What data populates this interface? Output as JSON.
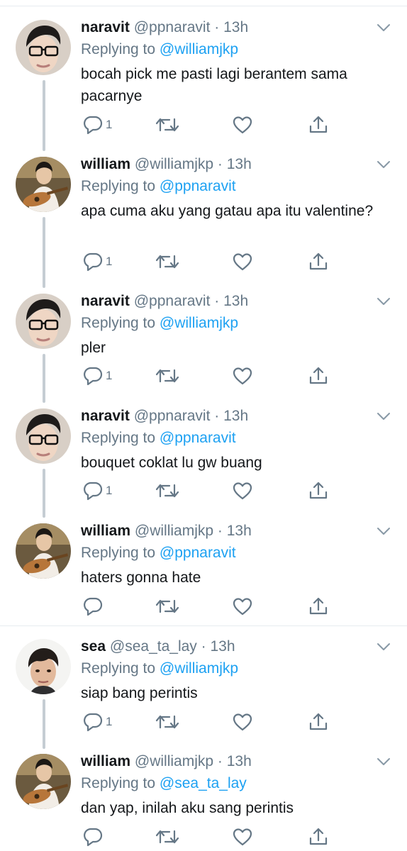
{
  "tweets": [
    {
      "name": "naravit",
      "handle": "@ppnaravit",
      "dot": " · ",
      "time": "13h",
      "reply_prefix": "Replying to ",
      "reply_to": "@williamjkp",
      "text": "bocah pick me pasti lagi berantem sama pacarnye",
      "reply_count": "1",
      "avatar": "naravit"
    },
    {
      "name": "william",
      "handle": "@williamjkp",
      "dot": " · ",
      "time": "13h",
      "reply_prefix": "Replying to ",
      "reply_to": "@ppnaravit",
      "text": "apa cuma aku yang gatau apa itu valentine?",
      "reply_count": "1",
      "avatar": "william"
    },
    {
      "name": "naravit",
      "handle": "@ppnaravit",
      "dot": " · ",
      "time": "13h",
      "reply_prefix": "Replying to ",
      "reply_to": "@williamjkp",
      "text": "pler",
      "reply_count": "1",
      "avatar": "naravit"
    },
    {
      "name": "naravit",
      "handle": "@ppnaravit",
      "dot": " · ",
      "time": "13h",
      "reply_prefix": "Replying to ",
      "reply_to": "@ppnaravit",
      "text": "bouquet coklat lu gw buang",
      "reply_count": "1",
      "avatar": "naravit"
    },
    {
      "name": "william",
      "handle": "@williamjkp",
      "dot": " · ",
      "time": "13h",
      "reply_prefix": "Replying to ",
      "reply_to": "@ppnaravit",
      "text": "haters gonna hate",
      "reply_count": "",
      "avatar": "william"
    },
    {
      "name": "sea",
      "handle": "@sea_ta_lay",
      "dot": " · ",
      "time": "13h",
      "reply_prefix": "Replying to ",
      "reply_to": "@williamjkp",
      "text": "siap bang perintis",
      "reply_count": "1",
      "avatar": "sea"
    },
    {
      "name": "william",
      "handle": "@williamjkp",
      "dot": " · ",
      "time": "13h",
      "reply_prefix": "Replying to ",
      "reply_to": "@sea_ta_lay",
      "text": "dan yap, inilah aku sang perintis",
      "reply_count": "",
      "avatar": "william"
    }
  ],
  "icons": {
    "reply": "reply-icon",
    "retweet": "retweet-icon",
    "like": "heart-icon",
    "share": "share-icon",
    "menu": "chevron-down-icon"
  },
  "colors": {
    "link": "#1da1f2",
    "secondary": "#657786",
    "thread_line": "#c5cdd3"
  }
}
